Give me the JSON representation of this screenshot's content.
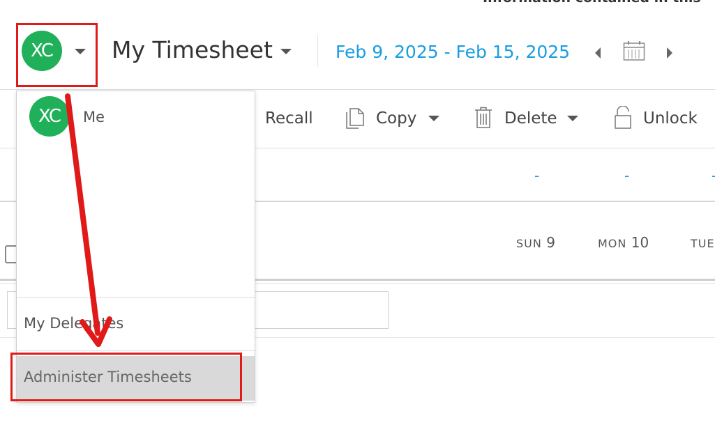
{
  "banner_text": "Information contained in this",
  "header": {
    "avatar_initials": "XC",
    "title": "My Timesheet",
    "date_range": "Feb 9, 2025 - Feb 15, 2025"
  },
  "toolbar": {
    "recall_label": "Recall",
    "copy_label": "Copy",
    "delete_label": "Delete",
    "unlock_label": "Unlock"
  },
  "summary_dashes": [
    "-",
    "-",
    "-"
  ],
  "days": [
    {
      "name": "SUN",
      "num": "9"
    },
    {
      "name": "MON",
      "num": "10"
    },
    {
      "name": "TUE",
      "num": ""
    }
  ],
  "user_menu": {
    "avatar_initials": "XC",
    "me_label": "Me",
    "delegates_label": "My Delegates",
    "administer_label": "Administer Timesheets"
  },
  "colors": {
    "accent": "#1a9de0",
    "avatar": "#21b05a",
    "annotation": "#e01919",
    "menu_highlight": "#d9d9d9"
  }
}
